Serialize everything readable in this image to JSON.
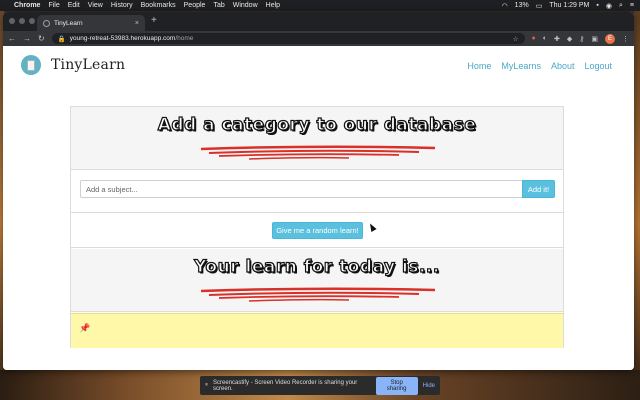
{
  "menubar": {
    "app": "Chrome",
    "items": [
      "File",
      "Edit",
      "View",
      "History",
      "Bookmarks",
      "People",
      "Tab",
      "Window",
      "Help"
    ],
    "battery": "13%",
    "clock": "Thu 1:29 PM"
  },
  "browser": {
    "tab_title": "TinyLearn",
    "url_host": "young-retreat-53983.herokuapp.com",
    "url_path": "/home",
    "profile_initial": "E"
  },
  "site": {
    "brand": "TinyLearn",
    "nav": [
      "Home",
      "MyLearns",
      "About",
      "Logout"
    ],
    "header_title": "Add a category to our database",
    "subject_placeholder": "Add a subject...",
    "add_button": "Add it!",
    "random_button": "Give me a random learn!",
    "learn_title": "Your learn for today is..."
  },
  "recorder": {
    "message": "Screencastify - Screen Video Recorder is sharing your screen.",
    "stop": "Stop sharing",
    "hide": "Hide"
  },
  "colors": {
    "accent": "#5bc0de",
    "link": "#4aa8c8",
    "note_bg": "#fff8a8",
    "scribble": "#d9302a"
  }
}
